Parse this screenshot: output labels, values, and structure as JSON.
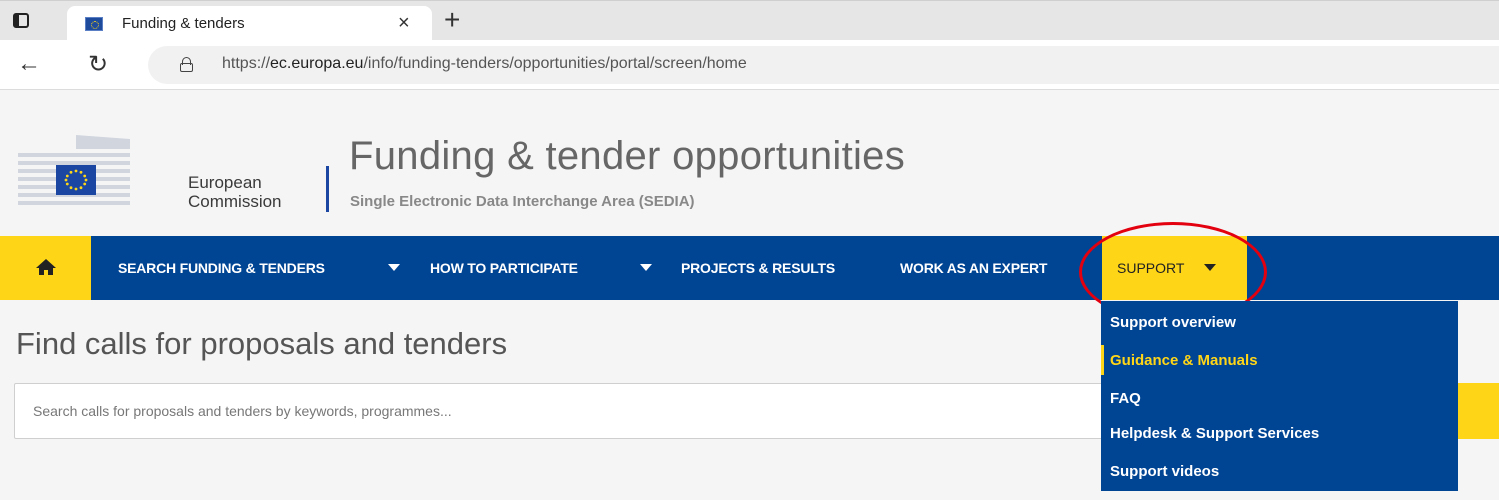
{
  "browser": {
    "tab_title": "Funding & tenders",
    "tab_close": "×",
    "new_tab": "+",
    "url_prefix": "https://",
    "url_domain": "ec.europa.eu",
    "url_path": "/info/funding-tenders/opportunities/portal/screen/home"
  },
  "header": {
    "org_line1": "European",
    "org_line2": "Commission",
    "title": "Funding & tender opportunities",
    "subtitle": "Single Electronic Data Interchange Area (SEDIA)"
  },
  "nav": {
    "items": [
      {
        "label": "SEARCH FUNDING & TENDERS"
      },
      {
        "label": "HOW TO PARTICIPATE"
      },
      {
        "label": "PROJECTS & RESULTS"
      },
      {
        "label": "WORK AS AN EXPERT"
      },
      {
        "label": "SUPPORT"
      }
    ],
    "support_menu": [
      {
        "label": "Support overview"
      },
      {
        "label": "Guidance & Manuals"
      },
      {
        "label": "FAQ"
      },
      {
        "label": "Helpdesk & Support Services"
      },
      {
        "label": "Support videos"
      }
    ]
  },
  "main": {
    "title": "Find calls for proposals and tenders",
    "search_placeholder": "Search calls for proposals and tenders by keywords, programmes..."
  },
  "colors": {
    "nav_blue": "#004494",
    "accent_yellow": "#ffd617",
    "annotation_red": "#e3000f"
  }
}
